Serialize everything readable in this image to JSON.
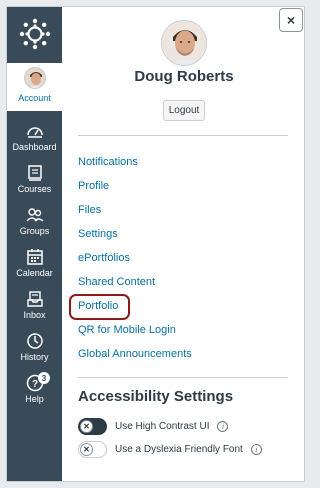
{
  "nav": {
    "account_label": "Account",
    "items": [
      {
        "label": "Dashboard",
        "icon": "dashboard-icon"
      },
      {
        "label": "Courses",
        "icon": "courses-icon"
      },
      {
        "label": "Groups",
        "icon": "groups-icon"
      },
      {
        "label": "Calendar",
        "icon": "calendar-icon"
      },
      {
        "label": "Inbox",
        "icon": "inbox-icon"
      },
      {
        "label": "History",
        "icon": "history-icon"
      },
      {
        "label": "Help",
        "icon": "help-icon",
        "badge": "3"
      }
    ]
  },
  "tray": {
    "close_label": "×",
    "user_name": "Doug Roberts",
    "logout_label": "Logout",
    "links": [
      "Notifications",
      "Profile",
      "Files",
      "Settings",
      "ePortfolios",
      "Shared Content",
      "Portfolio",
      "QR for Mobile Login",
      "Global Announcements"
    ],
    "highlighted_link": "Portfolio",
    "accessibility": {
      "title": "Accessibility Settings",
      "toggles": [
        {
          "label": "Use High Contrast UI",
          "state": "off"
        },
        {
          "label": "Use a Dyslexia Friendly Font",
          "state": "off"
        }
      ],
      "toggle_knob_glyph": "✕",
      "info_glyph": "i"
    }
  },
  "colors": {
    "nav_bg": "#394b58",
    "link": "#0770a3",
    "highlight_outline": "#8b1a1a"
  }
}
